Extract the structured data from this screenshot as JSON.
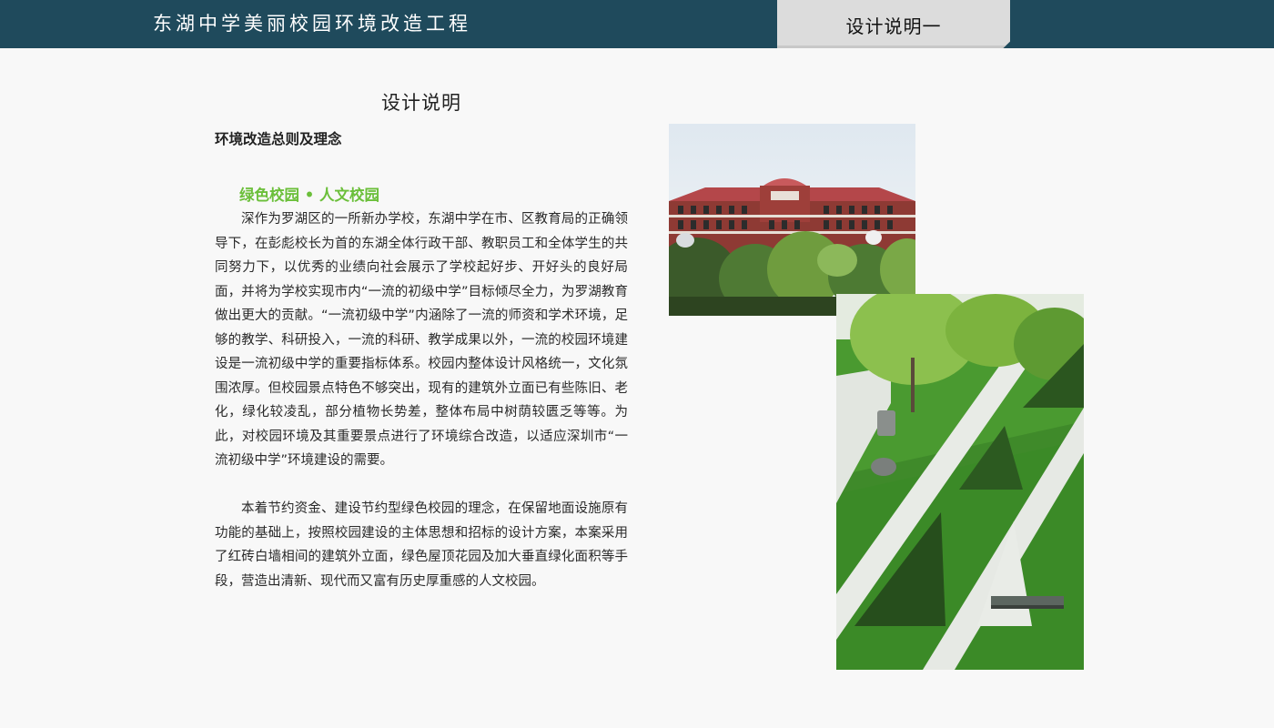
{
  "header": {
    "project_title": "东湖中学美丽校园环境改造工程",
    "tab_label": "设计说明一"
  },
  "content": {
    "heading": "设计说明",
    "subheading": "环境改造总则及理念",
    "motto": "绿色校园 • 人文校园",
    "paragraph1": "深作为罗湖区的一所新办学校，东湖中学在市、区教育局的正确领导下，在彭彪校长为首的东湖全体行政干部、教职员工和全体学生的共同努力下，以优秀的业绩向社会展示了学校起好步、开好头的良好局面，并将为学校实现市内“一流的初级中学”目标倾尽全力，为罗湖教育做出更大的贡献。“一流初级中学”内涵除了一流的师资和学术环境，足够的教学、科研投入，一流的科研、教学成果以外，一流的校园环境建设是一流初级中学的重要指标体系。校园内整体设计风格统一，文化氛围浓厚。但校园景点特色不够突出，现有的建筑外立面已有些陈旧、老化，绿化较凌乱，部分植物长势差，整体布局中树荫较匮乏等等。为此，对校园环境及其重要景点进行了环境综合改造，以适应深圳市“一流初级中学”环境建设的需要。",
    "paragraph2": "本着节约资金、建设节约型绿色校园的理念，在保留地面设施原有功能的基础上，按照校园建设的主体思想和招标的设计方案，本案采用了红砖白墙相间的建筑外立面，绿色屋顶花园及加大垂直绿化面积等手段，营造出清新、现代而又富有历史厚重感的人文校园。"
  },
  "colors": {
    "header_bg": "#1f4a5c",
    "tab_bg": "#dcdcdc",
    "motto": "#6bbf3a"
  }
}
